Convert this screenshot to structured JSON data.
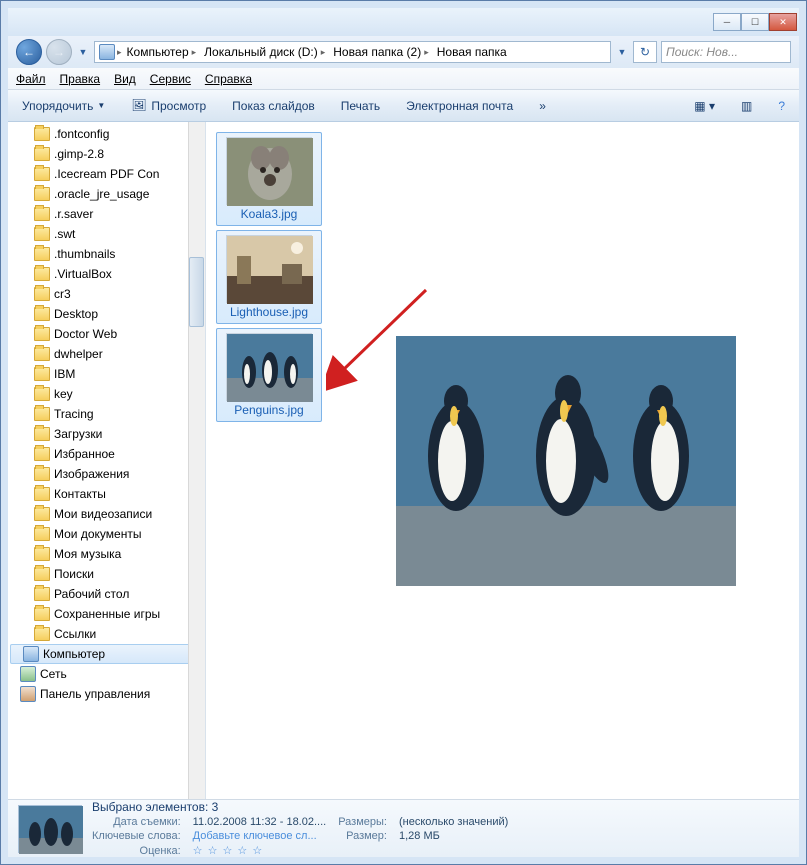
{
  "breadcrumbs": [
    "Компьютер",
    "Локальный диск (D:)",
    "Новая папка (2)",
    "Новая папка"
  ],
  "search_placeholder": "Поиск: Нов...",
  "menu": {
    "file": "Файл",
    "edit": "Правка",
    "view": "Вид",
    "tools": "Сервис",
    "help": "Справка"
  },
  "toolbar": {
    "organize": "Упорядочить",
    "preview": "Просмотр",
    "slideshow": "Показ слайдов",
    "print": "Печать",
    "email": "Электронная почта",
    "more": "»"
  },
  "sidebar": {
    "items": [
      ".fontconfig",
      ".gimp-2.8",
      ".Icecream PDF Con",
      ".oracle_jre_usage",
      ".r.saver",
      ".swt",
      ".thumbnails",
      ".VirtualBox",
      "cr3",
      "Desktop",
      "Doctor Web",
      "dwhelper",
      "IBM",
      "key",
      "Tracing",
      "Загрузки",
      "Избранное",
      "Изображения",
      "Контакты",
      "Мои видеозаписи",
      "Мои документы",
      "Моя музыка",
      "Поиски",
      "Рабочий стол",
      "Сохраненные игры",
      "Ссылки"
    ],
    "computer": "Компьютер",
    "network": "Сеть",
    "controlpanel": "Панель управления"
  },
  "files": [
    {
      "name": "Koala3.jpg"
    },
    {
      "name": "Lighthouse.jpg"
    },
    {
      "name": "Penguins.jpg"
    }
  ],
  "status": {
    "selected": "Выбрано элементов: 3",
    "date_label": "Дата съемки:",
    "date_val": "11.02.2008 11:32 - 18.02....",
    "dims_label": "Размеры:",
    "dims_val": "(несколько значений)",
    "keywords_label": "Ключевые слова:",
    "keywords_val": "Добавьте ключевое сл...",
    "size_label": "Размер:",
    "size_val": "1,28 МБ",
    "rating_label": "Оценка:",
    "rating_val": "☆ ☆ ☆ ☆ ☆"
  }
}
